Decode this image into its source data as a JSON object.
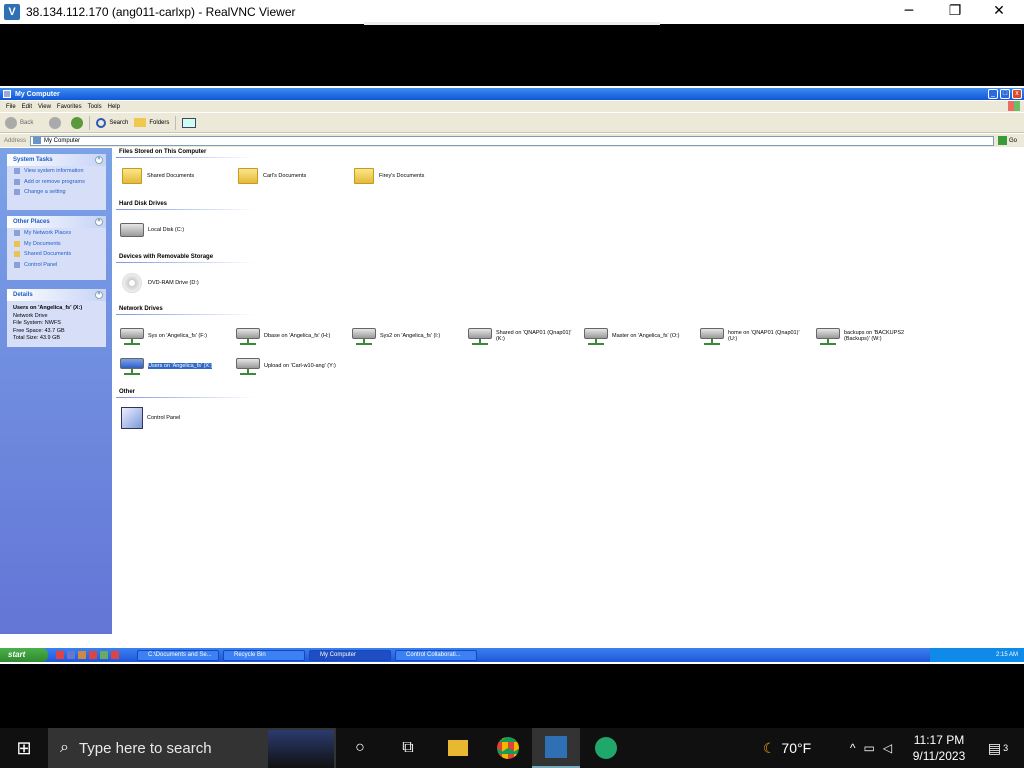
{
  "vnc": {
    "title": "38.134.112.170 (ang011-carlxp) - RealVNC Viewer",
    "minimize": "─",
    "restore": "❐",
    "close": "✕"
  },
  "xp_window": {
    "title": "My Computer",
    "menu": [
      "File",
      "Edit",
      "View",
      "Favorites",
      "Tools",
      "Help"
    ],
    "toolbar": {
      "back": "Back",
      "search": "Search",
      "folders": "Folders"
    },
    "address": {
      "label": "Address",
      "value": "My Computer",
      "go": "Go"
    }
  },
  "task_pane": {
    "system_tasks": {
      "title": "System Tasks",
      "items": [
        "View system information",
        "Add or remove programs",
        "Change a setting"
      ]
    },
    "other_places": {
      "title": "Other Places",
      "items": [
        "My Network Places",
        "My Documents",
        "Shared Documents",
        "Control Panel"
      ]
    },
    "details": {
      "title": "Details",
      "name": "Users on 'Angelica_fs' (X:)",
      "type": "Network Drive",
      "filesystem": "File System: NWFS",
      "free": "Free Space: 43.7 GB",
      "total": "Total Size: 43.9 GB"
    }
  },
  "content": {
    "groups": {
      "files": "Files Stored on This Computer",
      "hdd": "Hard Disk Drives",
      "removable": "Devices with Removable Storage",
      "network": "Network Drives",
      "other": "Other"
    },
    "files": [
      "Shared Documents",
      "Carl's Documents",
      "Firey's Documents"
    ],
    "hdd": [
      "Local Disk (C:)"
    ],
    "removable": [
      "DVD-RAM Drive (D:)"
    ],
    "network": [
      "Sys on 'Angelica_fs' (F:)",
      "Dbase on 'Angelica_fs' (H:)",
      "Sys2 on 'Angelica_fs' (I:)",
      "Shared on 'QNAP01 (Qnap01)' (K:)",
      "Master on 'Angelica_fs' (O:)",
      "home on 'QNAP01 (Qnap01)' (U:)",
      "backups on 'BACKUPS2 (Backups)' (W:)",
      "Users on 'Angelica_fs' (X:)",
      "Upload on 'Carl-w10-ang' (Y:)"
    ],
    "other": [
      "Control Panel"
    ]
  },
  "xp_taskbar": {
    "start": "start",
    "tasks": [
      "C:\\Documents and Se...",
      "Recycle Bin",
      "My Computer",
      "Control Collaborati..."
    ],
    "time": "2:15 AM"
  },
  "win_taskbar": {
    "search_placeholder": "Type here to search",
    "weather": "70°F",
    "time": "11:17 PM",
    "date": "9/11/2023",
    "notifications": "3"
  }
}
